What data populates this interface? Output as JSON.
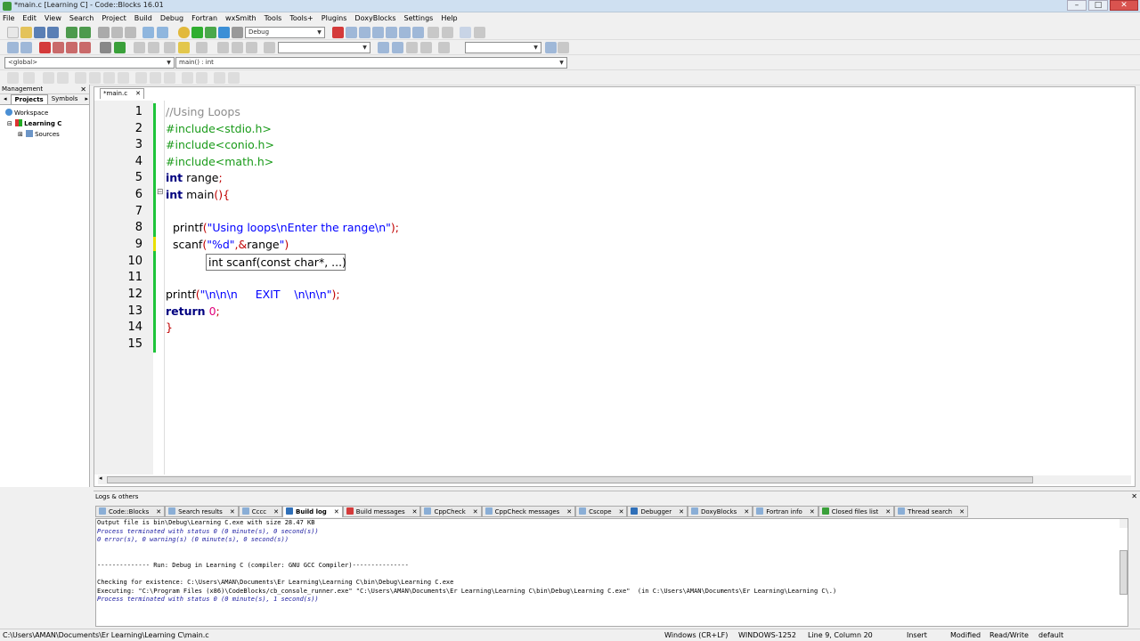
{
  "window": {
    "title": "*main.c [Learning C] - Code::Blocks 16.01",
    "min": "–",
    "max": "□",
    "close": "✕"
  },
  "menu": [
    "File",
    "Edit",
    "View",
    "Search",
    "Project",
    "Build",
    "Debug",
    "Fortran",
    "wxSmith",
    "Tools",
    "Tools+",
    "Plugins",
    "DoxyBlocks",
    "Settings",
    "Help"
  ],
  "toolbar": {
    "build_target": "Debug",
    "scope": "<global>",
    "function": "main() : int"
  },
  "management": {
    "title": "Management",
    "close": "✕",
    "tabs": [
      "Projects",
      "Symbols"
    ],
    "tree": {
      "workspace": "Workspace",
      "project": "Learning C",
      "sources": "Sources"
    }
  },
  "editor": {
    "tab": "*main.c",
    "tab_close": "✕",
    "lines": [
      "1",
      "2",
      "3",
      "4",
      "5",
      "6",
      "7",
      "8",
      "9",
      "10",
      "11",
      "12",
      "13",
      "14",
      "15"
    ],
    "tooltip": "int scanf(const char*, ...)"
  },
  "logs": {
    "title": "Logs & others",
    "close": "✕",
    "tabs": [
      "Code::Blocks",
      "Search results",
      "Cccc",
      "Build log",
      "Build messages",
      "CppCheck",
      "CppCheck messages",
      "Cscope",
      "Debugger",
      "DoxyBlocks",
      "Fortran info",
      "Closed files list",
      "Thread search"
    ],
    "tab_close": "✕",
    "active_tab": "Build log",
    "output": [
      "Output file is bin\\Debug\\Learning C.exe with size 28.47 KB",
      "Process terminated with status 0 (0 minute(s), 0 second(s))",
      "0 error(s), 0 warning(s) (0 minute(s), 0 second(s))",
      "",
      "",
      "-------------- Run: Debug in Learning C (compiler: GNU GCC Compiler)---------------",
      "",
      "Checking for existence: C:\\Users\\AMAN\\Documents\\Er Learning\\Learning C\\bin\\Debug\\Learning C.exe",
      "Executing: \"C:\\Program Files (x86)\\CodeBlocks/cb_console_runner.exe\" \"C:\\Users\\AMAN\\Documents\\Er Learning\\Learning C\\bin\\Debug\\Learning C.exe\"  (in C:\\Users\\AMAN\\Documents\\Er Learning\\Learning C\\.)",
      "Process terminated with status 0 (0 minute(s), 1 second(s))"
    ]
  },
  "status": {
    "path": "C:\\Users\\AMAN\\Documents\\Er Learning\\Learning C\\main.c",
    "eol": "Windows (CR+LF)",
    "encoding": "WINDOWS-1252",
    "position": "Line 9, Column 20",
    "mode": "Insert",
    "modified": "Modified",
    "access": "Read/Write",
    "profile": "default"
  }
}
